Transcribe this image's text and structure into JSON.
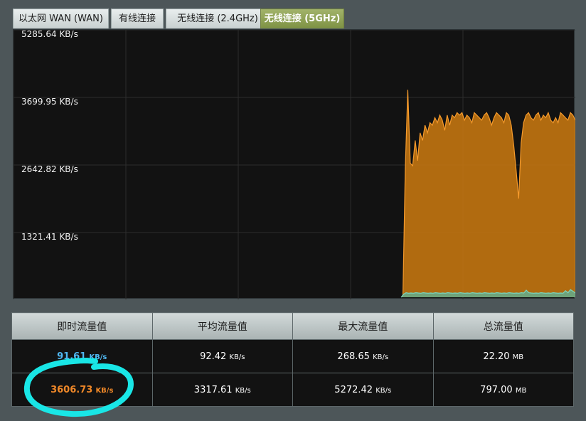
{
  "tabs": [
    {
      "label": "以太网 WAN (WAN)",
      "active": false
    },
    {
      "label": "有线连接",
      "active": false
    },
    {
      "label": "无线连接 (2.4GHz)",
      "active": false
    },
    {
      "label": "无线连接 (5GHz)",
      "active": true
    }
  ],
  "chart_data": {
    "type": "area",
    "y_labels": [
      "5285.64 KB/s",
      "3699.95 KB/s",
      "2642.82 KB/s",
      "1321.41 KB/s"
    ],
    "ylim": [
      0,
      5285.64
    ],
    "grid": true,
    "series": [
      {
        "color": "#c77710",
        "values": [
          0,
          0,
          0,
          0,
          0,
          0,
          0,
          0,
          0,
          0,
          0,
          0,
          0,
          0,
          0,
          0,
          0,
          0,
          0,
          0,
          0,
          0,
          0,
          0,
          0,
          0,
          0,
          0,
          0,
          0,
          0,
          0,
          0,
          0,
          0,
          0,
          0,
          0,
          0,
          0,
          0,
          0,
          0,
          0,
          0,
          0,
          0,
          0,
          0,
          0,
          0,
          0,
          0,
          0,
          0,
          0,
          0,
          0,
          0,
          0,
          0,
          0,
          0,
          0,
          0,
          0,
          0,
          0,
          0,
          0,
          0,
          0,
          0,
          0,
          0,
          0,
          0,
          0,
          0,
          0,
          0,
          0,
          0,
          0,
          0,
          0,
          0,
          0,
          0,
          0,
          0,
          0,
          0,
          0,
          0,
          0,
          0,
          0,
          0,
          0,
          0,
          0,
          0,
          0,
          0,
          0,
          0,
          0,
          0,
          0,
          0,
          0,
          0,
          0,
          0,
          0,
          0,
          0,
          0,
          0,
          0,
          0,
          0,
          0,
          0,
          0,
          0,
          0,
          0,
          0,
          0,
          0,
          0,
          0,
          0,
          0,
          0,
          0,
          0,
          0,
          0,
          0,
          0,
          0,
          0,
          0,
          0,
          0,
          0,
          0,
          0,
          0,
          0,
          0,
          0,
          0,
          0,
          0,
          0,
          2550,
          4100,
          2650,
          2600,
          3100,
          2700,
          3250,
          3100,
          3400,
          3250,
          3450,
          3400,
          3550,
          3450,
          3600,
          3500,
          3300,
          3600,
          3400,
          3600,
          3550,
          3650,
          3600,
          3650,
          3500,
          3600,
          3550,
          3450,
          3650,
          3600,
          3550,
          3500,
          3600,
          3650,
          3550,
          3400,
          3550,
          3650,
          3600,
          3550,
          3450,
          3650,
          3600,
          3400,
          3000,
          2500,
          1950,
          3050,
          3450,
          3600,
          3650,
          3550,
          3500,
          3600,
          3650,
          3500,
          3600,
          3550,
          3650,
          3500,
          3450,
          3550,
          3450,
          3650,
          3600,
          3550,
          3500,
          3650,
          3600,
          3500
        ]
      },
      {
        "color": "#5ab59e",
        "values": [
          0,
          0,
          0,
          0,
          0,
          0,
          0,
          0,
          0,
          0,
          0,
          0,
          0,
          0,
          0,
          0,
          0,
          0,
          0,
          0,
          0,
          0,
          0,
          0,
          0,
          0,
          0,
          0,
          0,
          0,
          0,
          0,
          0,
          0,
          0,
          0,
          0,
          0,
          0,
          0,
          0,
          0,
          0,
          0,
          0,
          0,
          0,
          0,
          0,
          0,
          0,
          0,
          0,
          0,
          0,
          0,
          0,
          0,
          0,
          0,
          0,
          0,
          0,
          0,
          0,
          0,
          0,
          0,
          0,
          0,
          0,
          0,
          0,
          0,
          0,
          0,
          0,
          0,
          0,
          0,
          0,
          0,
          0,
          0,
          0,
          0,
          0,
          0,
          0,
          0,
          0,
          0,
          0,
          0,
          0,
          0,
          0,
          0,
          0,
          0,
          0,
          0,
          0,
          0,
          0,
          0,
          0,
          0,
          0,
          0,
          0,
          0,
          0,
          0,
          0,
          0,
          0,
          0,
          0,
          0,
          0,
          0,
          0,
          0,
          0,
          0,
          0,
          0,
          0,
          0,
          0,
          0,
          0,
          0,
          0,
          0,
          0,
          0,
          0,
          0,
          0,
          0,
          0,
          0,
          0,
          0,
          0,
          0,
          0,
          0,
          0,
          0,
          0,
          0,
          0,
          0,
          0,
          0,
          0,
          60,
          90,
          80,
          85,
          80,
          90,
          85,
          80,
          90,
          85,
          80,
          85,
          80,
          90,
          85,
          80,
          85,
          80,
          90,
          85,
          80,
          85,
          80,
          90,
          85,
          80,
          85,
          80,
          90,
          85,
          80,
          85,
          80,
          90,
          85,
          80,
          85,
          80,
          90,
          85,
          80,
          85,
          80,
          90,
          85,
          80,
          85,
          80,
          90,
          85,
          140,
          90,
          85,
          80,
          85,
          80,
          90,
          85,
          80,
          85,
          80,
          90,
          85,
          80,
          85,
          80,
          130,
          90,
          150,
          120,
          85
        ]
      }
    ]
  },
  "stats": {
    "headers": [
      "即时流量值",
      "平均流量值",
      "最大流量值",
      "总流量值"
    ],
    "rows": [
      {
        "current": "91.61",
        "current_unit": "KB/s",
        "average": "92.42",
        "average_unit": "KB/s",
        "max": "268.65",
        "max_unit": "KB/s",
        "total": "22.20",
        "total_unit": "MB"
      },
      {
        "current": "3606.73",
        "current_unit": "KB/s",
        "average": "3317.61",
        "average_unit": "KB/s",
        "max": "5272.42",
        "max_unit": "KB/s",
        "total": "797.00",
        "total_unit": "MB"
      }
    ]
  },
  "colors": {
    "receive": "#4fb6ef",
    "transmit": "#f08828",
    "annotation": "#19e6e6",
    "active_tab": "#8ea04f"
  }
}
